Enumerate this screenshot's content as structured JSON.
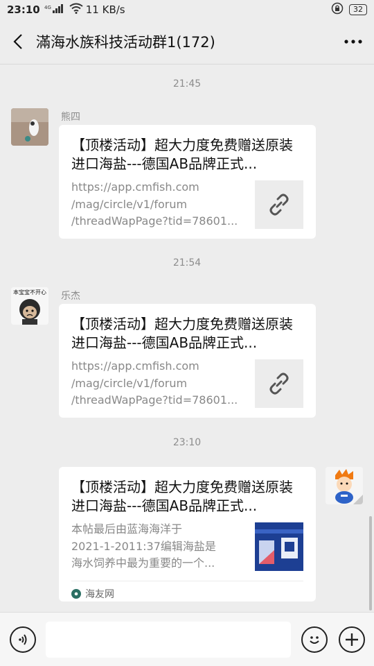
{
  "status_bar": {
    "time": "23:10",
    "signal": "4G",
    "speed": "11 KB/s",
    "battery": "32"
  },
  "header": {
    "title": "滿海水族科技活动群1(172)"
  },
  "messages": [
    {
      "timestamp": "21:45",
      "sender": "熊四",
      "title": "【顶楼活动】超大力度免费赠送原装进口海盐---德国AB品牌正式...",
      "desc_lines": [
        "https://app.cmfish.com",
        "/mag/circle/v1/forum",
        "/threadWapPage?tid=78601..."
      ]
    },
    {
      "timestamp": "21:54",
      "sender": "乐杰",
      "avatar_text": "本宝宝不开心",
      "title": "【顶楼活动】超大力度免费赠送原装进口海盐---德国AB品牌正式...",
      "desc_lines": [
        "https://app.cmfish.com",
        "/mag/circle/v1/forum",
        "/threadWapPage?tid=78601..."
      ]
    },
    {
      "timestamp": "23:10",
      "title": "【顶楼活动】超大力度免费赠送原装进口海盐---德国AB品牌正式...",
      "desc_lines": [
        "本帖最后由蓝海海洋于",
        "2021-1-2011:37编辑海盐是",
        "海水饲养中最为重要的一个..."
      ],
      "source": "海友网"
    }
  ],
  "colors": {
    "background": "#ededed",
    "card": "#ffffff",
    "muted_text": "#8c8c8c"
  },
  "icons": [
    "back-arrow-icon",
    "more-icon",
    "link-icon",
    "voice-icon",
    "emoji-icon",
    "plus-icon"
  ]
}
